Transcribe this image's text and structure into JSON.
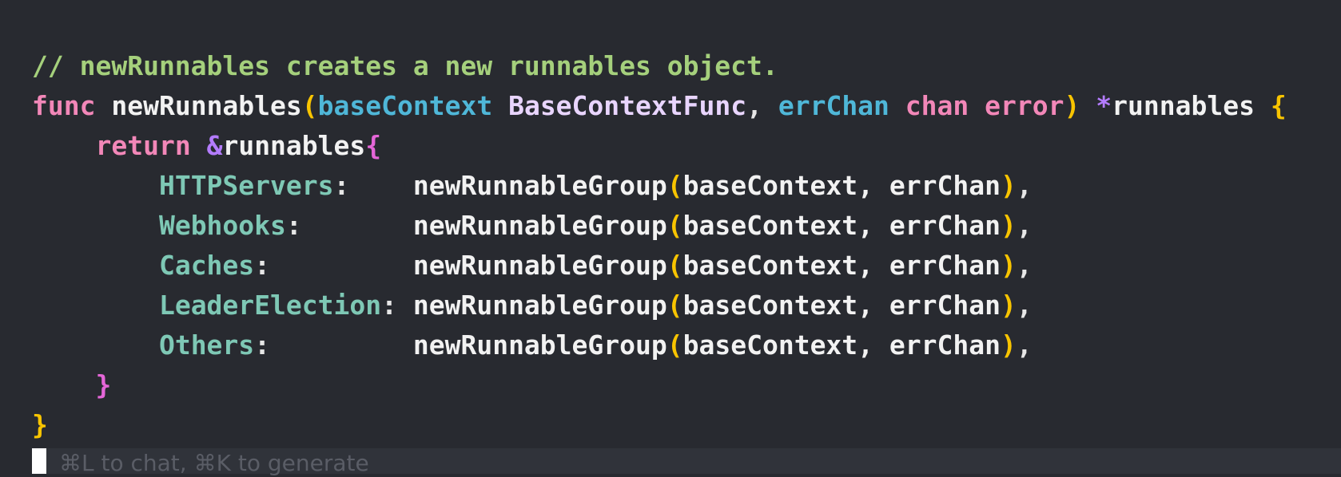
{
  "code": {
    "comment": "// newRunnables creates a new runnables object.",
    "line1": {
      "kw_func": "func",
      "fn_name": "newRunnables",
      "open_paren": "(",
      "param1": "baseContext",
      "type1": "BaseContextFunc",
      "comma": ",",
      "param2": "errChan",
      "kw_chan": "chan",
      "kw_error": "error",
      "close_paren": ")",
      "star": "*",
      "ret_type": "runnables",
      "open_brace": "{"
    },
    "line2": {
      "kw_return": "return",
      "amp": "&",
      "type": "runnables",
      "open_brace": "{"
    },
    "fields": [
      {
        "name": "HTTPServers",
        "pad": ":    ",
        "fn": "newRunnableGroup",
        "args": "baseContext, errChan",
        "tail": ","
      },
      {
        "name": "Webhooks",
        "pad": ":       ",
        "fn": "newRunnableGroup",
        "args": "baseContext, errChan",
        "tail": ","
      },
      {
        "name": "Caches",
        "pad": ":         ",
        "fn": "newRunnableGroup",
        "args": "baseContext, errChan",
        "tail": ","
      },
      {
        "name": "LeaderElection",
        "pad": ": ",
        "fn": "newRunnableGroup",
        "args": "baseContext, errChan",
        "tail": ","
      },
      {
        "name": "Others",
        "pad": ":         ",
        "fn": "newRunnableGroup",
        "args": "baseContext, errChan",
        "tail": ","
      }
    ],
    "inner_close": "}",
    "outer_close": "}"
  },
  "chat_bar": {
    "hint": "⌘L to chat, ⌘K to generate"
  }
}
